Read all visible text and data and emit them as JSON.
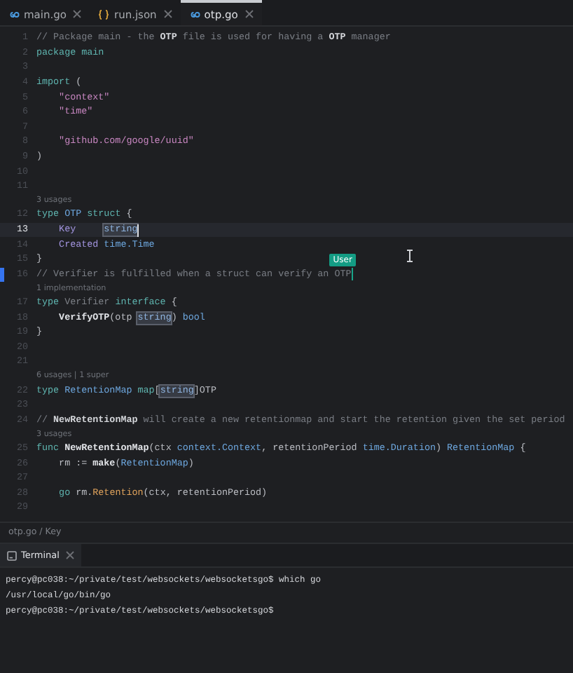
{
  "tabs": [
    {
      "label": "main.go",
      "kind": "go",
      "selected": false
    },
    {
      "label": "run.json",
      "kind": "json",
      "selected": false
    },
    {
      "label": "otp.go",
      "kind": "go",
      "selected": true
    }
  ],
  "editor": {
    "lines": [
      {
        "number": "1",
        "current": false,
        "modified": false,
        "caret": false,
        "tokens": [
          {
            "kind": "com",
            "text": "// Package main - the "
          },
          {
            "kind": "combold",
            "text": "OTP"
          },
          {
            "kind": "com",
            "text": " file is used for having a "
          },
          {
            "kind": "combold",
            "text": "OTP"
          },
          {
            "kind": "com",
            "text": " manager"
          }
        ]
      },
      {
        "number": "2",
        "current": false,
        "modified": false,
        "caret": false,
        "tokens": [
          {
            "kind": "kw",
            "text": "package main"
          }
        ]
      },
      {
        "number": "3",
        "current": false,
        "modified": false,
        "caret": false
      },
      {
        "number": "4",
        "current": false,
        "modified": false,
        "caret": false,
        "tokens": [
          {
            "kind": "kw",
            "text": "import"
          },
          {
            "kind": "plain",
            "text": " ("
          }
        ]
      },
      {
        "number": "5",
        "current": false,
        "modified": false,
        "caret": false,
        "tokens": [
          {
            "kind": "str",
            "text": "    \"context\""
          }
        ]
      },
      {
        "number": "6",
        "current": false,
        "modified": false,
        "caret": false,
        "tokens": [
          {
            "kind": "str",
            "text": "    \"time\""
          }
        ]
      },
      {
        "number": "7",
        "current": false,
        "modified": false,
        "caret": false
      },
      {
        "number": "8",
        "current": false,
        "modified": false,
        "caret": false,
        "tokens": [
          {
            "kind": "str",
            "text": "    \"github.com/google/uuid\""
          }
        ]
      },
      {
        "number": "9",
        "current": false,
        "modified": false,
        "caret": false,
        "tokens": [
          {
            "kind": "plain",
            "text": ")"
          }
        ]
      },
      {
        "number": "10",
        "current": false,
        "modified": false,
        "caret": false
      },
      {
        "number": "11",
        "current": false,
        "modified": false,
        "caret": false
      },
      {
        "number": "12",
        "annotation": "3 usages",
        "current": false,
        "modified": false,
        "caret": false,
        "tokens": [
          {
            "kind": "kw",
            "text": "type "
          },
          {
            "kind": "type",
            "text": "OTP "
          },
          {
            "kind": "kw",
            "text": "struct"
          },
          {
            "kind": "plain",
            "text": " {"
          }
        ]
      },
      {
        "number": "13",
        "current": true,
        "modified": false,
        "caret": true,
        "tokens": [
          {
            "kind": "field",
            "text": "    Key     "
          },
          {
            "kind": "hl",
            "text": "string"
          }
        ]
      },
      {
        "number": "14",
        "current": false,
        "modified": false,
        "caret": false,
        "tokens": [
          {
            "kind": "field",
            "text": "    Created "
          },
          {
            "kind": "type",
            "text": "time.Time"
          }
        ]
      },
      {
        "number": "15",
        "current": false,
        "modified": false,
        "caret": false,
        "tokens": [
          {
            "kind": "plain",
            "text": "}"
          }
        ]
      },
      {
        "number": "16",
        "current": false,
        "modified": true,
        "caret": true,
        "collaborator": "User",
        "tokens": [
          {
            "kind": "com",
            "text": "// Verifier is fulfilled when a struct can verify an OTP"
          }
        ]
      },
      {
        "number": "17",
        "annotation": "1 implementation",
        "current": false,
        "modified": false,
        "caret": false,
        "tokens": [
          {
            "kind": "kw",
            "text": "type "
          },
          {
            "kind": "unused",
            "text": "Verifier "
          },
          {
            "kind": "kw",
            "text": "interface"
          },
          {
            "kind": "plain",
            "text": " {"
          }
        ]
      },
      {
        "number": "18",
        "current": false,
        "modified": false,
        "caret": false,
        "tokens": [
          {
            "kind": "fn",
            "text": "    VerifyOTP"
          },
          {
            "kind": "plain",
            "text": "(otp "
          },
          {
            "kind": "hl",
            "text": "string"
          },
          {
            "kind": "plain",
            "text": ") "
          },
          {
            "kind": "type",
            "text": "bool"
          }
        ]
      },
      {
        "number": "19",
        "current": false,
        "modified": false,
        "caret": false,
        "tokens": [
          {
            "kind": "plain",
            "text": "}"
          }
        ]
      },
      {
        "number": "20",
        "current": false,
        "modified": false,
        "caret": false
      },
      {
        "number": "21",
        "current": false,
        "modified": false,
        "caret": false
      },
      {
        "number": "22",
        "annotation": "6 usages | 1 super",
        "current": false,
        "modified": false,
        "caret": false,
        "tokens": [
          {
            "kind": "kw",
            "text": "type "
          },
          {
            "kind": "type",
            "text": "RetentionMap "
          },
          {
            "kind": "kw",
            "text": "map"
          },
          {
            "kind": "plain",
            "text": "["
          },
          {
            "kind": "hl",
            "text": "string"
          },
          {
            "kind": "plain",
            "text": "]OTP"
          }
        ]
      },
      {
        "number": "23",
        "current": false,
        "modified": false,
        "caret": false
      },
      {
        "number": "24",
        "current": false,
        "modified": false,
        "caret": false,
        "tokens": [
          {
            "kind": "com",
            "text": "// "
          },
          {
            "kind": "combold",
            "text": "NewRetentionMap"
          },
          {
            "kind": "com",
            "text": " will create a new retentionmap and start the retention given the set period"
          }
        ]
      },
      {
        "number": "25",
        "annotation": "3 usages",
        "current": false,
        "modified": false,
        "caret": false,
        "tokens": [
          {
            "kind": "kw",
            "text": "func "
          },
          {
            "kind": "fn",
            "text": "NewRetentionMap"
          },
          {
            "kind": "plain",
            "text": "(ctx "
          },
          {
            "kind": "type",
            "text": "context.Context"
          },
          {
            "kind": "plain",
            "text": ", retentionPeriod "
          },
          {
            "kind": "type",
            "text": "time.Duration"
          },
          {
            "kind": "plain",
            "text": ") "
          },
          {
            "kind": "type",
            "text": "RetentionMap"
          },
          {
            "kind": "plain",
            "text": " {"
          }
        ]
      },
      {
        "number": "26",
        "current": false,
        "modified": false,
        "caret": false,
        "tokens": [
          {
            "kind": "plain",
            "text": "    rm := "
          },
          {
            "kind": "fn",
            "text": "make"
          },
          {
            "kind": "plain",
            "text": "("
          },
          {
            "kind": "type",
            "text": "RetentionMap"
          },
          {
            "kind": "plain",
            "text": ")"
          }
        ]
      },
      {
        "number": "27",
        "current": false,
        "modified": false,
        "caret": false
      },
      {
        "number": "28",
        "current": false,
        "modified": false,
        "caret": false,
        "tokens": [
          {
            "kind": "kw",
            "text": "    go"
          },
          {
            "kind": "plain",
            "text": " rm."
          },
          {
            "kind": "method",
            "text": "Retention"
          },
          {
            "kind": "plain",
            "text": "(ctx, retentionPeriod)"
          }
        ]
      },
      {
        "number": "29",
        "current": false,
        "modified": false,
        "caret": false
      }
    ]
  },
  "breadcrumb": "otp.go / Key",
  "terminal": {
    "tab": {
      "label": "Terminal",
      "selected": true
    },
    "lines": [
      "percy@pc038:~/private/test/websockets/websocketsgo$ which go",
      "/usr/local/go/bin/go",
      "percy@pc038:~/private/test/websockets/websocketsgo$"
    ]
  }
}
